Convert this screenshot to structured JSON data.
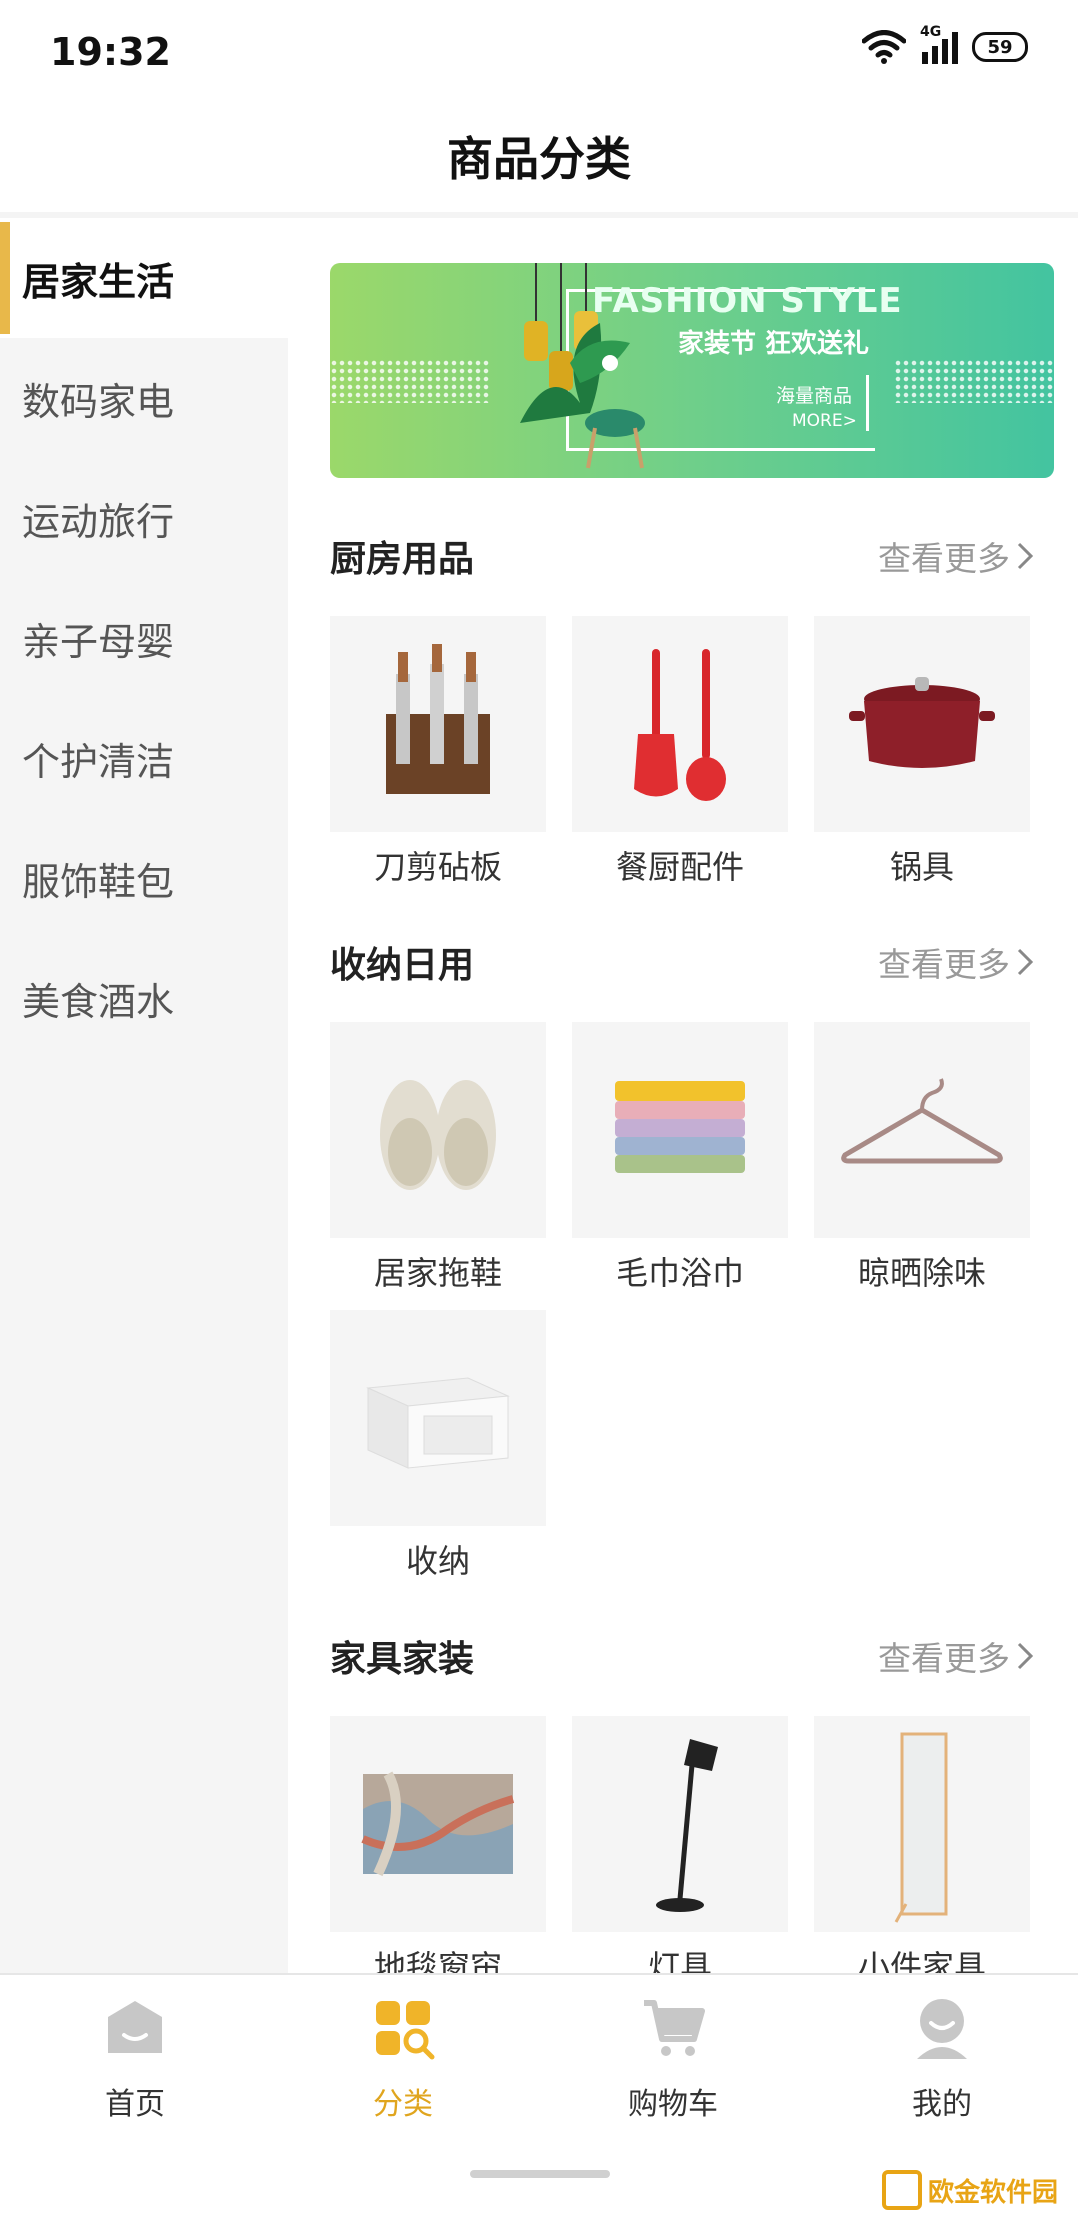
{
  "status_bar": {
    "time": "19:32",
    "network": "4G",
    "battery": "59"
  },
  "header": {
    "title": "商品分类"
  },
  "sidebar": {
    "items": [
      {
        "label": "居家生活",
        "active": true
      },
      {
        "label": "数码家电",
        "active": false
      },
      {
        "label": "运动旅行",
        "active": false
      },
      {
        "label": "亲子母婴",
        "active": false
      },
      {
        "label": "个护清洁",
        "active": false
      },
      {
        "label": "服饰鞋包",
        "active": false
      },
      {
        "label": "美食酒水",
        "active": false
      }
    ]
  },
  "banner": {
    "title": "FASHION STYLE",
    "subtitle": "家装节 狂欢送礼",
    "tag": "海量商品",
    "more": "MORE>"
  },
  "sections": [
    {
      "title": "厨房用品",
      "more": "查看更多",
      "items": [
        {
          "label": "刀剪砧板",
          "icon": "knife-block-icon"
        },
        {
          "label": "餐厨配件",
          "icon": "spatula-ladle-icon"
        },
        {
          "label": "锅具",
          "icon": "pot-icon"
        }
      ]
    },
    {
      "title": "收纳日用",
      "more": "查看更多",
      "items": [
        {
          "label": "居家拖鞋",
          "icon": "slippers-icon"
        },
        {
          "label": "毛巾浴巾",
          "icon": "towels-icon"
        },
        {
          "label": "晾晒除味",
          "icon": "hanger-icon"
        },
        {
          "label": "收纳",
          "icon": "storage-box-icon"
        }
      ]
    },
    {
      "title": "家具家装",
      "more": "查看更多",
      "items": [
        {
          "label": "地毯窗帘",
          "icon": "rug-icon"
        },
        {
          "label": "灯具",
          "icon": "floor-lamp-icon"
        },
        {
          "label": "小件家具",
          "icon": "mirror-icon"
        }
      ]
    }
  ],
  "tabbar": {
    "items": [
      {
        "label": "首页",
        "icon": "home-icon",
        "active": false
      },
      {
        "label": "分类",
        "icon": "category-icon",
        "active": true
      },
      {
        "label": "购物车",
        "icon": "cart-icon",
        "active": false
      },
      {
        "label": "我的",
        "icon": "user-icon",
        "active": false
      }
    ]
  },
  "watermark": {
    "text": "欧金软件园"
  },
  "colors": {
    "accent": "#e8b84a",
    "active_tab": "#e0a51e",
    "sidebar_bg": "#f5f5f5"
  }
}
